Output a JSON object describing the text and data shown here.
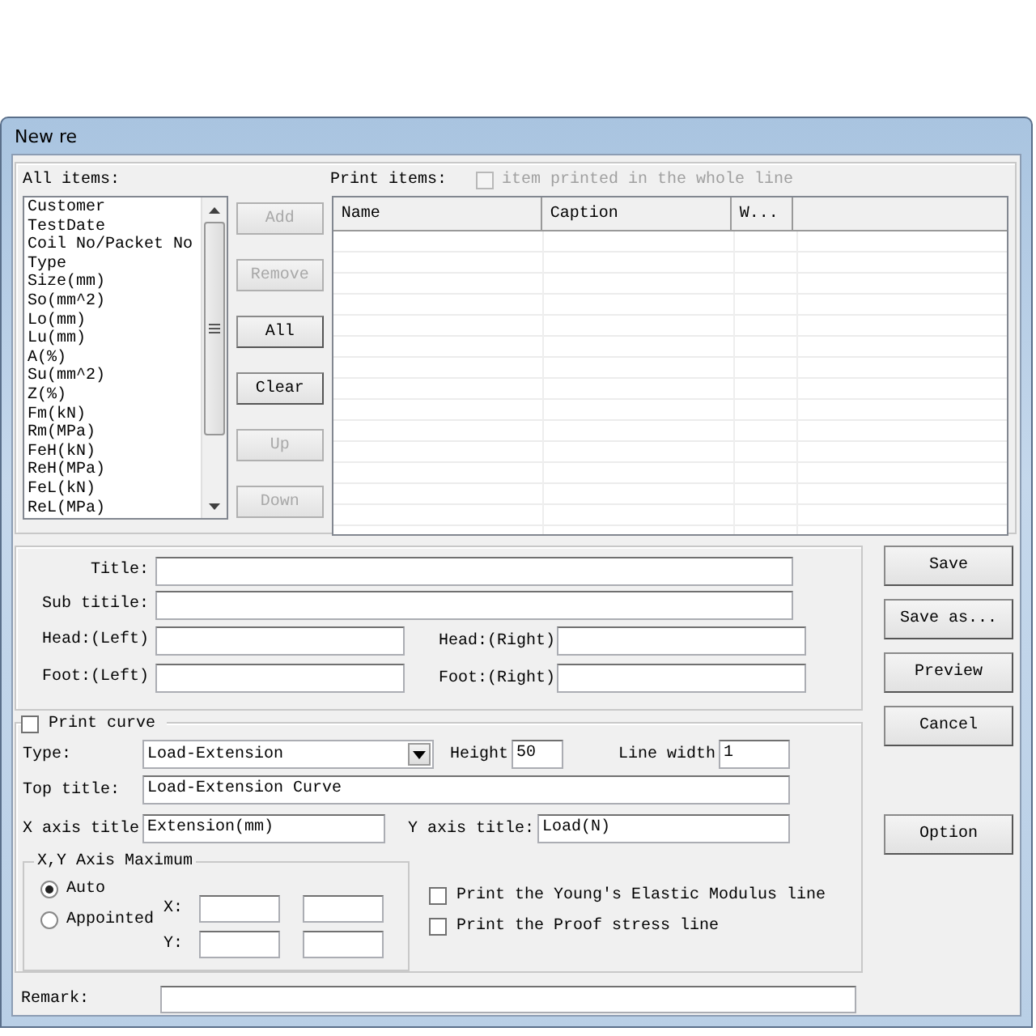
{
  "window": {
    "title": "New re"
  },
  "all_items": {
    "label": "All items:",
    "items": [
      "Customer",
      "TestDate",
      "Coil No/Packet No",
      "Type",
      "Size(mm)",
      "So(mm^2)",
      "Lo(mm)",
      "Lu(mm)",
      "A(%)",
      "Su(mm^2)",
      "Z(%)",
      "Fm(kN)",
      "Rm(MPa)",
      "FeH(kN)",
      "ReH(MPa)",
      "FeL(kN)",
      "ReL(MPa)"
    ]
  },
  "item_buttons": [
    {
      "label": "Add",
      "disabled": true
    },
    {
      "label": "Remove",
      "disabled": true
    },
    {
      "label": "All",
      "disabled": false
    },
    {
      "label": "Clear",
      "disabled": false
    },
    {
      "label": "Up",
      "disabled": true
    },
    {
      "label": "Down",
      "disabled": true
    }
  ],
  "print_items": {
    "label": "Print items:",
    "whole_line": {
      "label": "item printed in the whole line",
      "checked": false,
      "disabled": true
    },
    "columns": [
      "Name",
      "Caption",
      "W..."
    ]
  },
  "header_fields": [
    {
      "kind": "wide",
      "label": "Title:"
    },
    {
      "kind": "wide",
      "label": "Sub titile:"
    },
    {
      "kind": "half",
      "label": "Head:(Left)"
    },
    {
      "kind": "half",
      "label": "Head:(Right)"
    },
    {
      "kind": "half",
      "label": "Foot:(Left)"
    },
    {
      "kind": "half",
      "label": "Foot:(Right)"
    }
  ],
  "side_buttons": [
    {
      "label": "Save"
    },
    {
      "label": "Save as..."
    },
    {
      "label": "Preview"
    },
    {
      "label": "Cancel"
    },
    {
      "label": "Option"
    }
  ],
  "curve": {
    "print_curve": {
      "label": "Print curve",
      "checked": false
    },
    "type": {
      "label": "Type:",
      "value": "Load-Extension"
    },
    "height": {
      "label": "Height",
      "value": "50"
    },
    "line_width": {
      "label": "Line width",
      "value": "1"
    },
    "top_title": {
      "label": "Top title:",
      "value": "Load-Extension Curve"
    },
    "x_axis_title": {
      "label": "X axis title",
      "value": "Extension(mm)"
    },
    "y_axis_title": {
      "label": "Y axis title:",
      "value": "Load(N)"
    },
    "axis_max": {
      "legend": "X,Y Axis Maximum",
      "options": [
        {
          "label": "Auto",
          "selected": true
        },
        {
          "label": "Appointed",
          "selected": false
        }
      ],
      "x_label": "X:",
      "y_label": "Y:"
    },
    "lines": [
      {
        "label": "Print the Young's Elastic Modulus line",
        "checked": false
      },
      {
        "label": "Print the Proof stress line",
        "checked": false
      }
    ]
  },
  "remark": {
    "label": "Remark:"
  }
}
